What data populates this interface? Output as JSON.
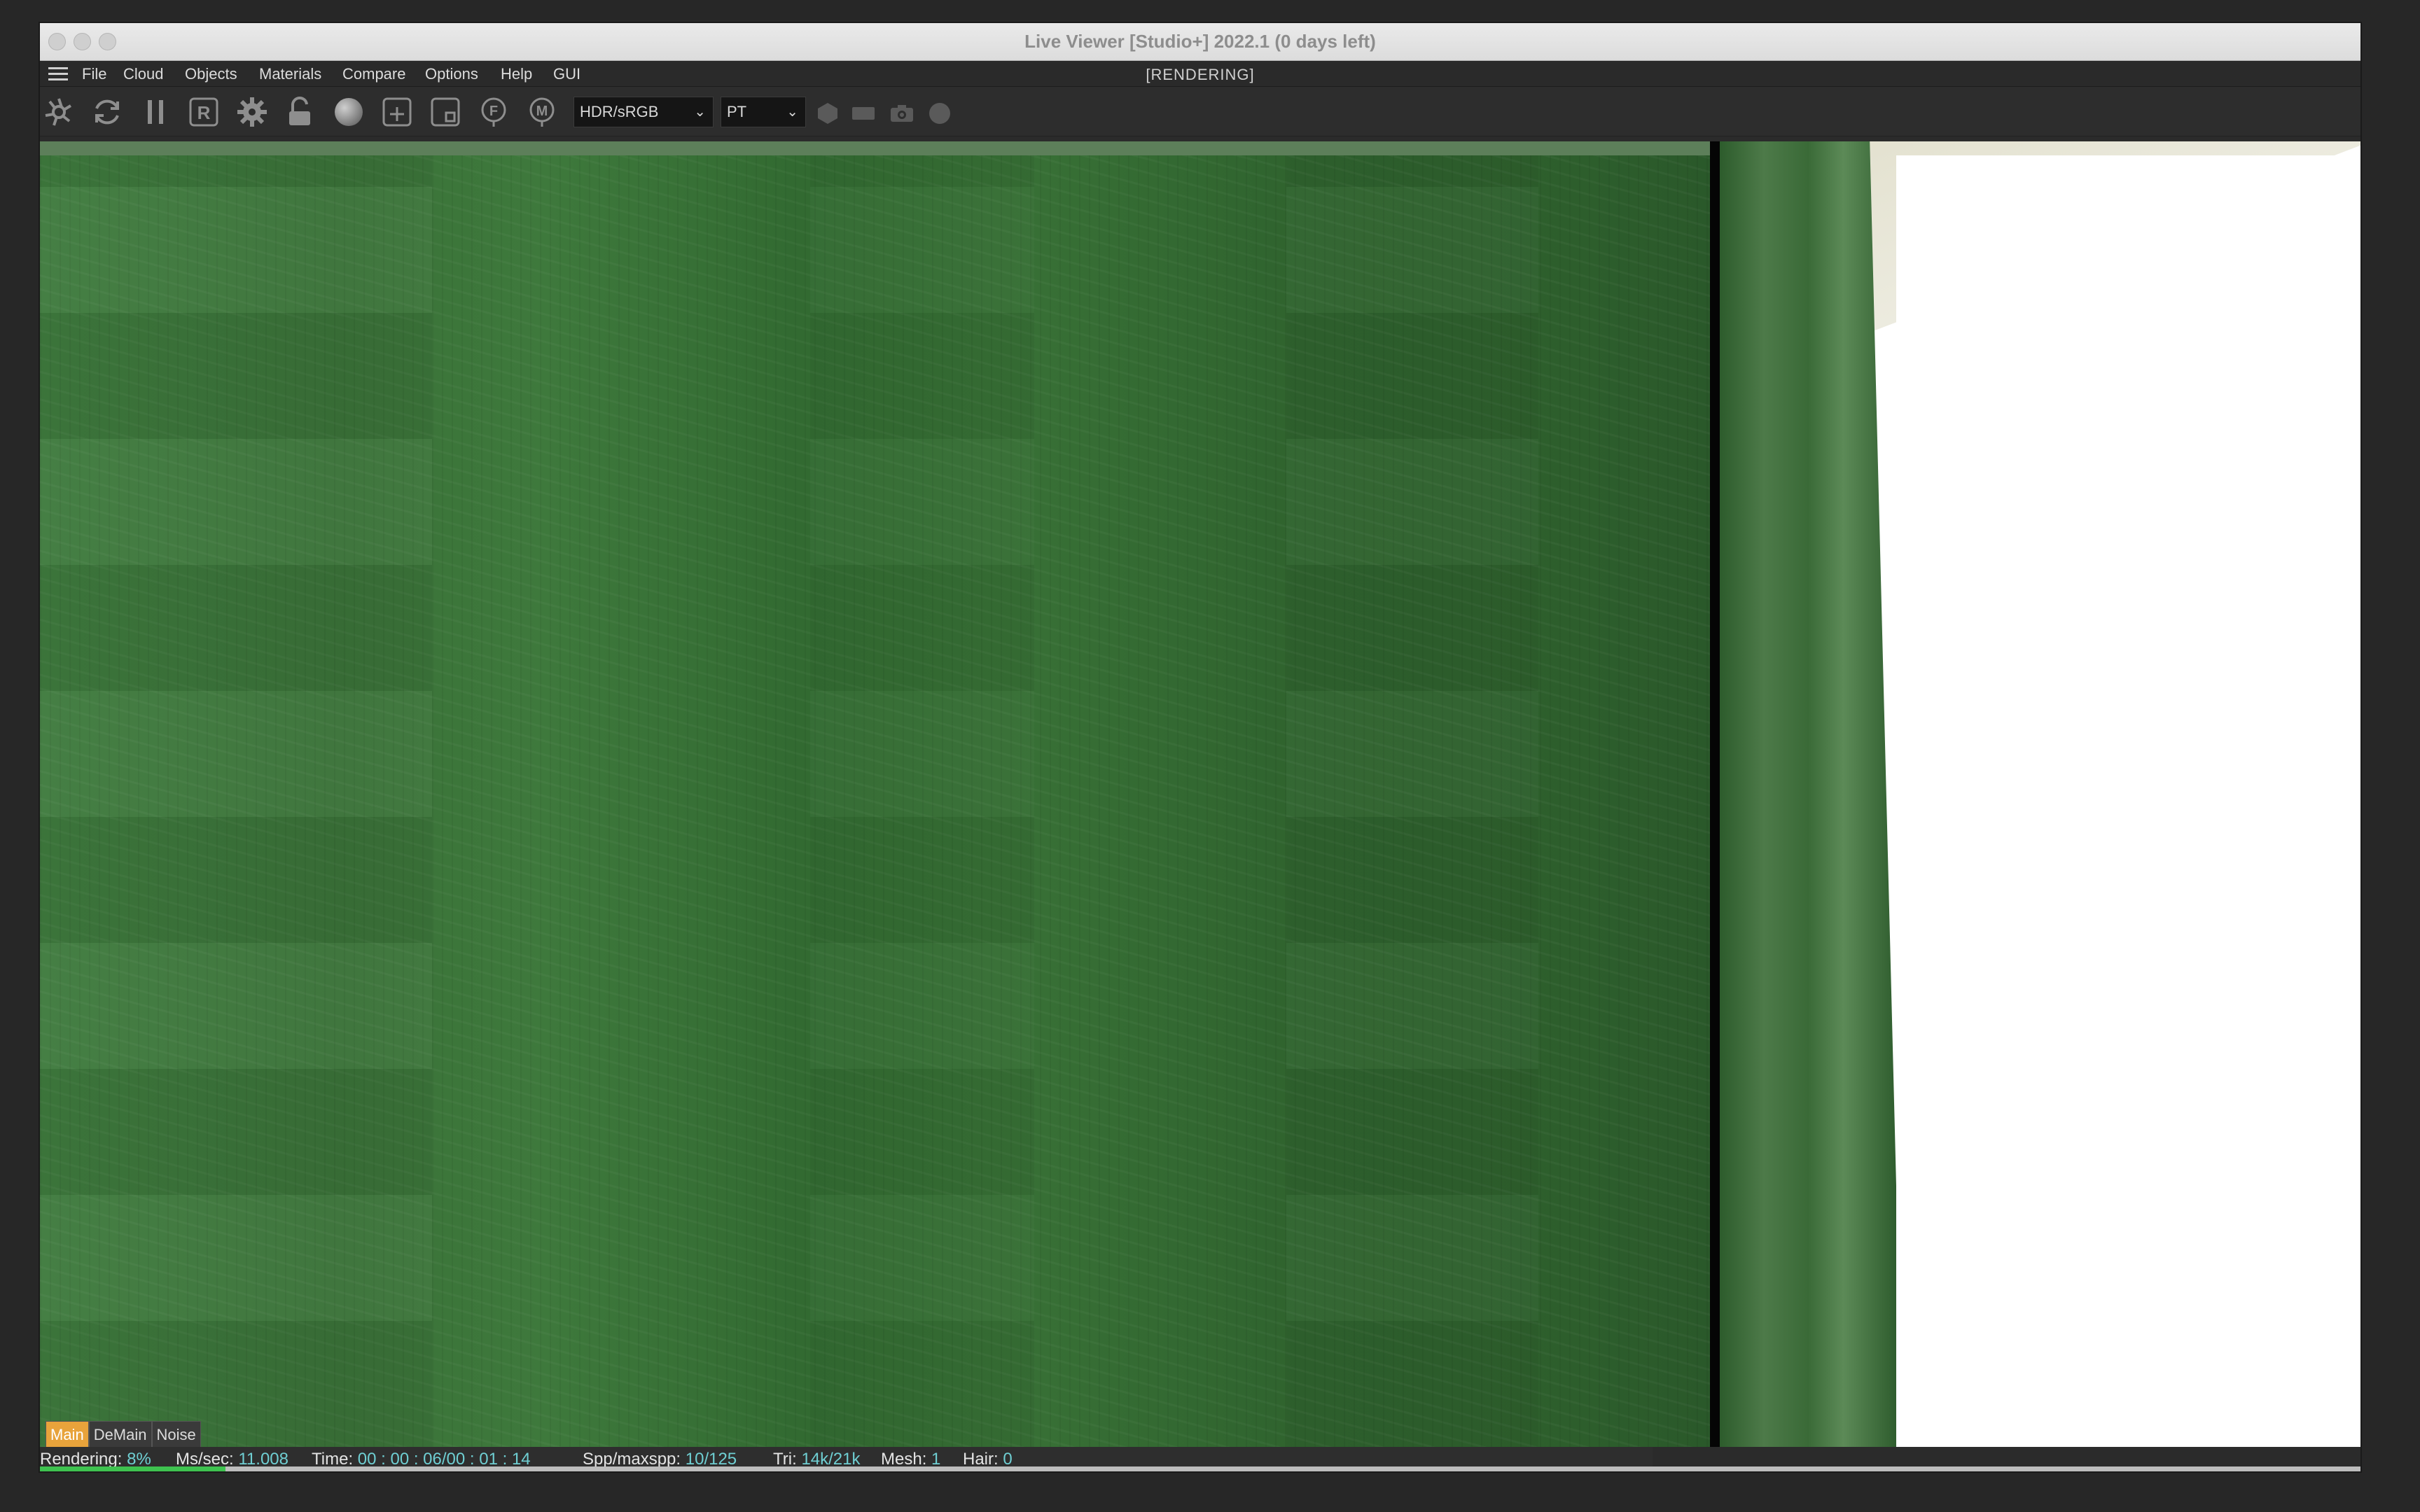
{
  "window": {
    "title": "Live Viewer [Studio+] 2022.1 (0 days left)"
  },
  "menu": {
    "items": [
      "File",
      "Cloud",
      "Objects",
      "Materials",
      "Compare",
      "Options",
      "Help",
      "GUI"
    ],
    "status": "[RENDERING]"
  },
  "toolbar": {
    "icons": [
      "aperture-icon",
      "refresh-icon",
      "pause-icon",
      "region-r-icon",
      "settings-gear-icon",
      "lock-icon",
      "sphere-icon",
      "add-region-icon",
      "film-region-icon",
      "focus-pick-icon",
      "material-pick-icon"
    ],
    "color_space": "HDR/sRGB",
    "kernel": "PT",
    "extra_icons": [
      "hexagon-icon",
      "rectangle-icon",
      "camera-icon",
      "circle-icon"
    ]
  },
  "aov_tabs": [
    "Main",
    "DeMain",
    "Noise"
  ],
  "statusbar": {
    "rendering_label": "Rendering:",
    "rendering_value": "8%",
    "mssec_label": "Ms/sec:",
    "mssec_value": "11.008",
    "time_label": "Time:",
    "time_value": "00 : 00 : 06/00 : 01 : 14",
    "spp_label": "Spp/maxspp:",
    "spp_value": "10/125",
    "tri_label": "Tri:",
    "tri_value": "14k/21k",
    "mesh_label": "Mesh:",
    "mesh_value": "1",
    "hair_label": "Hair:",
    "hair_value": "0"
  },
  "progress": {
    "fraction": 0.08
  },
  "colors": {
    "accent_tab": "#e8a33b",
    "stat_value": "#6fcfd3",
    "progress": "#3ec24f",
    "fabric": "#3a7238"
  }
}
